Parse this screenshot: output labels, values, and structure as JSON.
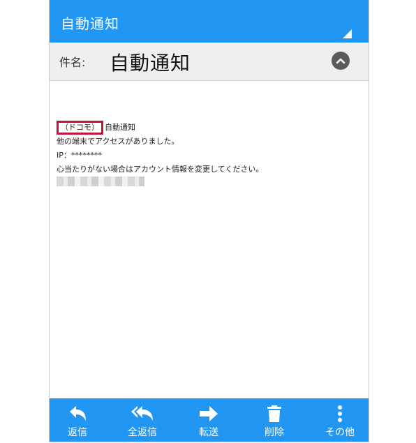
{
  "header": {
    "title": "自動通知"
  },
  "subject": {
    "label": "件名:",
    "value": "自動通知"
  },
  "message": {
    "tag": "（ドコモ）",
    "lines": [
      "自動通知",
      "他の端末でアクセスがありました。",
      "IP：********",
      "心当たりがない場合はアカウント情報を変更してください。"
    ]
  },
  "toolbar": {
    "reply": "返信",
    "reply_all": "全返信",
    "forward": "転送",
    "delete": "削除",
    "more": "その他"
  },
  "colors": {
    "accent": "#2196f3",
    "highlight": "#c0143c"
  },
  "icons": {
    "reply": "reply-icon",
    "reply_all": "reply-all-icon",
    "forward": "forward-icon",
    "delete": "trash-icon",
    "more": "more-vert-icon",
    "collapse": "chevron-up-icon"
  }
}
